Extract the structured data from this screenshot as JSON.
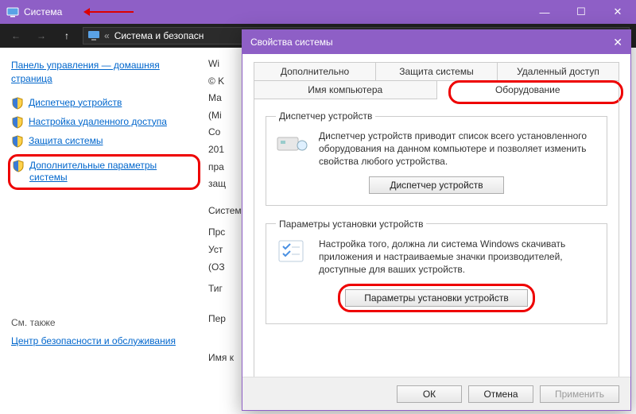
{
  "titlebar": {
    "title": "Система",
    "min": "—",
    "max": "☐",
    "close": "✕"
  },
  "nav": {
    "back": "←",
    "forward": "→",
    "up": "↑",
    "chevrons": "«",
    "breadcrumb": "Система и безопасн"
  },
  "left": {
    "home": "Панель управления — домашняя страница",
    "links": [
      "Диспетчер устройств",
      "Настройка удаленного доступа",
      "Защита системы",
      "Дополнительные параметры системы"
    ],
    "see_also_label": "См. также",
    "see_also_link": "Центр безопасности и обслуживания"
  },
  "mid": {
    "lines": [
      "Wi",
      "© K",
      "Ма",
      "(Mi",
      "Co",
      "201",
      "пра",
      "защ",
      "Систем",
      "Прс",
      "Уст",
      "(ОЗ",
      "Тиг",
      "Пер",
      "Имя к"
    ]
  },
  "dialog": {
    "title": "Свойства системы",
    "close": "✕",
    "tabs_row1": [
      "Дополнительно",
      "Защита системы",
      "Удаленный доступ"
    ],
    "tabs_row2": [
      "Имя компьютера",
      "Оборудование"
    ],
    "group1": {
      "legend": "Диспетчер устройств",
      "text": "Диспетчер устройств приводит список всего установленного оборудования на данном компьютере и позволяет изменить свойства любого устройства.",
      "button": "Диспетчер устройств"
    },
    "group2": {
      "legend": "Параметры установки устройств",
      "text": "Настройка того, должна ли система Windows скачивать приложения и настраиваемые значки производителей, доступные для ваших устройств.",
      "button": "Параметры установки устройств"
    },
    "footer": {
      "ok": "ОК",
      "cancel": "Отмена",
      "apply": "Применить"
    }
  }
}
